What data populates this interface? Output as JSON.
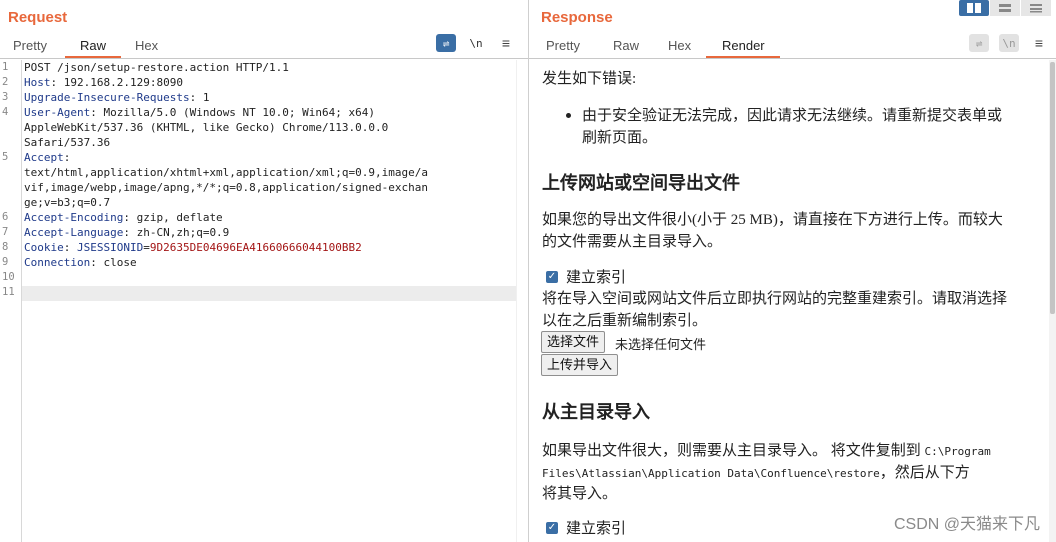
{
  "request": {
    "title": "Request",
    "tabs": [
      "Pretty",
      "Raw",
      "Hex"
    ],
    "active_tab": "Raw",
    "lines": [
      {
        "num": "1",
        "text": "POST /json/setup-restore.action HTTP/1.1"
      },
      {
        "num": "2",
        "key": "Host",
        "value": " 192.168.2.129:8090"
      },
      {
        "num": "3",
        "key": "Upgrade-Insecure-Requests",
        "value": " 1"
      },
      {
        "num": "4",
        "key": "User-Agent",
        "value": " Mozilla/5.0 (Windows NT 10.0; Win64; x64)"
      },
      {
        "num": "",
        "text": "AppleWebKit/537.36 (KHTML, like Gecko) Chrome/113.0.0.0"
      },
      {
        "num": "",
        "text": "Safari/537.36"
      },
      {
        "num": "5",
        "key": "Accept",
        "value": ""
      },
      {
        "num": "",
        "text": "text/html,application/xhtml+xml,application/xml;q=0.9,image/a"
      },
      {
        "num": "",
        "text": "vif,image/webp,image/apng,*/*;q=0.8,application/signed-exchan"
      },
      {
        "num": "",
        "text": "ge;v=b3;q=0.7"
      },
      {
        "num": "6",
        "key": "Accept-Encoding",
        "value": " gzip, deflate"
      },
      {
        "num": "7",
        "key": "Accept-Language",
        "value": " zh-CN,zh;q=0.9"
      },
      {
        "num": "8",
        "key": "Cookie",
        "cookie_name": "JSESSIONID",
        "cookie_value": "9D2635DE04696EA41660666044100BB2"
      },
      {
        "num": "9",
        "key": "Connection",
        "value": " close"
      },
      {
        "num": "10",
        "text": ""
      },
      {
        "num": "11",
        "text": ""
      }
    ],
    "icons": {
      "wrap": "wrap-lines-icon",
      "newline": "\\n",
      "menu": "menu-icon"
    }
  },
  "response": {
    "title": "Response",
    "tabs": [
      "Pretty",
      "Raw",
      "Hex",
      "Render"
    ],
    "active_tab": "Render",
    "render": {
      "error_intro": "发生如下错误:",
      "error_item_line1": "由于安全验证无法完成，因此请求无法继续。请重新提交表单或",
      "error_item_line2": "刷新页面。",
      "heading_upload": "上传网站或空间导出文件",
      "upload_desc_line1": "如果您的导出文件很小(小于 25 MB)，请直接在下方进行上传。而较大",
      "upload_desc_line2": "的文件需要从主目录导入。",
      "build_index_label": "建立索引",
      "build_index_desc_line1": "将在导入空间或网站文件后立即执行网站的完整重建索引。请取消选择",
      "build_index_desc_line2": "以在之后重新编制索引。",
      "choose_file_button": "选择文件",
      "no_file_text": "未选择任何文件",
      "upload_import_button": "上传并导入",
      "heading_home": "从主目录导入",
      "home_desc_prefix": "如果导出文件很大，则需要从主目录导入。 将文件复制到 ",
      "home_desc_path1": "C:\\Program",
      "home_desc_path2": "Files\\Atlassian\\Application Data\\Confluence\\restore",
      "home_desc_suffix": "，然后从下方",
      "home_desc_line3": "将其导入。",
      "build_index_label_2": "建立索引"
    }
  },
  "watermark": "CSDN @天猫来下凡"
}
